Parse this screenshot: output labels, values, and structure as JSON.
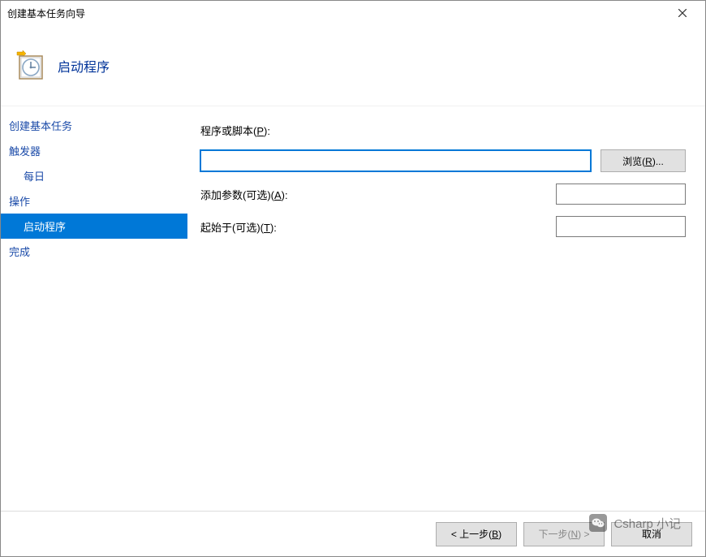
{
  "window": {
    "title": "创建基本任务向导"
  },
  "header": {
    "heading": "启动程序"
  },
  "sidebar": {
    "items": [
      {
        "label": "创建基本任务",
        "sub": false,
        "selected": false
      },
      {
        "label": "触发器",
        "sub": false,
        "selected": false
      },
      {
        "label": "每日",
        "sub": true,
        "selected": false
      },
      {
        "label": "操作",
        "sub": false,
        "selected": false
      },
      {
        "label": "启动程序",
        "sub": true,
        "selected": true
      },
      {
        "label": "完成",
        "sub": false,
        "selected": false
      }
    ]
  },
  "form": {
    "program": {
      "label": "程序或脚本(",
      "hotkey": "P",
      "label_after": "):",
      "value": ""
    },
    "browse": {
      "label": "浏览(",
      "hotkey": "R",
      "label_after": ")..."
    },
    "arguments": {
      "label": "添加参数(可选)(",
      "hotkey": "A",
      "label_after": "):",
      "value": ""
    },
    "startin": {
      "label": "起始于(可选)(",
      "hotkey": "T",
      "label_after": "):",
      "value": ""
    }
  },
  "footer": {
    "back": {
      "label": "< 上一步(",
      "hotkey": "B",
      "label_after": ")"
    },
    "next": {
      "label": "下一步(",
      "hotkey": "N",
      "label_after": ") >",
      "disabled": true
    },
    "cancel": {
      "label": "取消"
    }
  },
  "watermark": {
    "text": "Csharp 小记"
  }
}
